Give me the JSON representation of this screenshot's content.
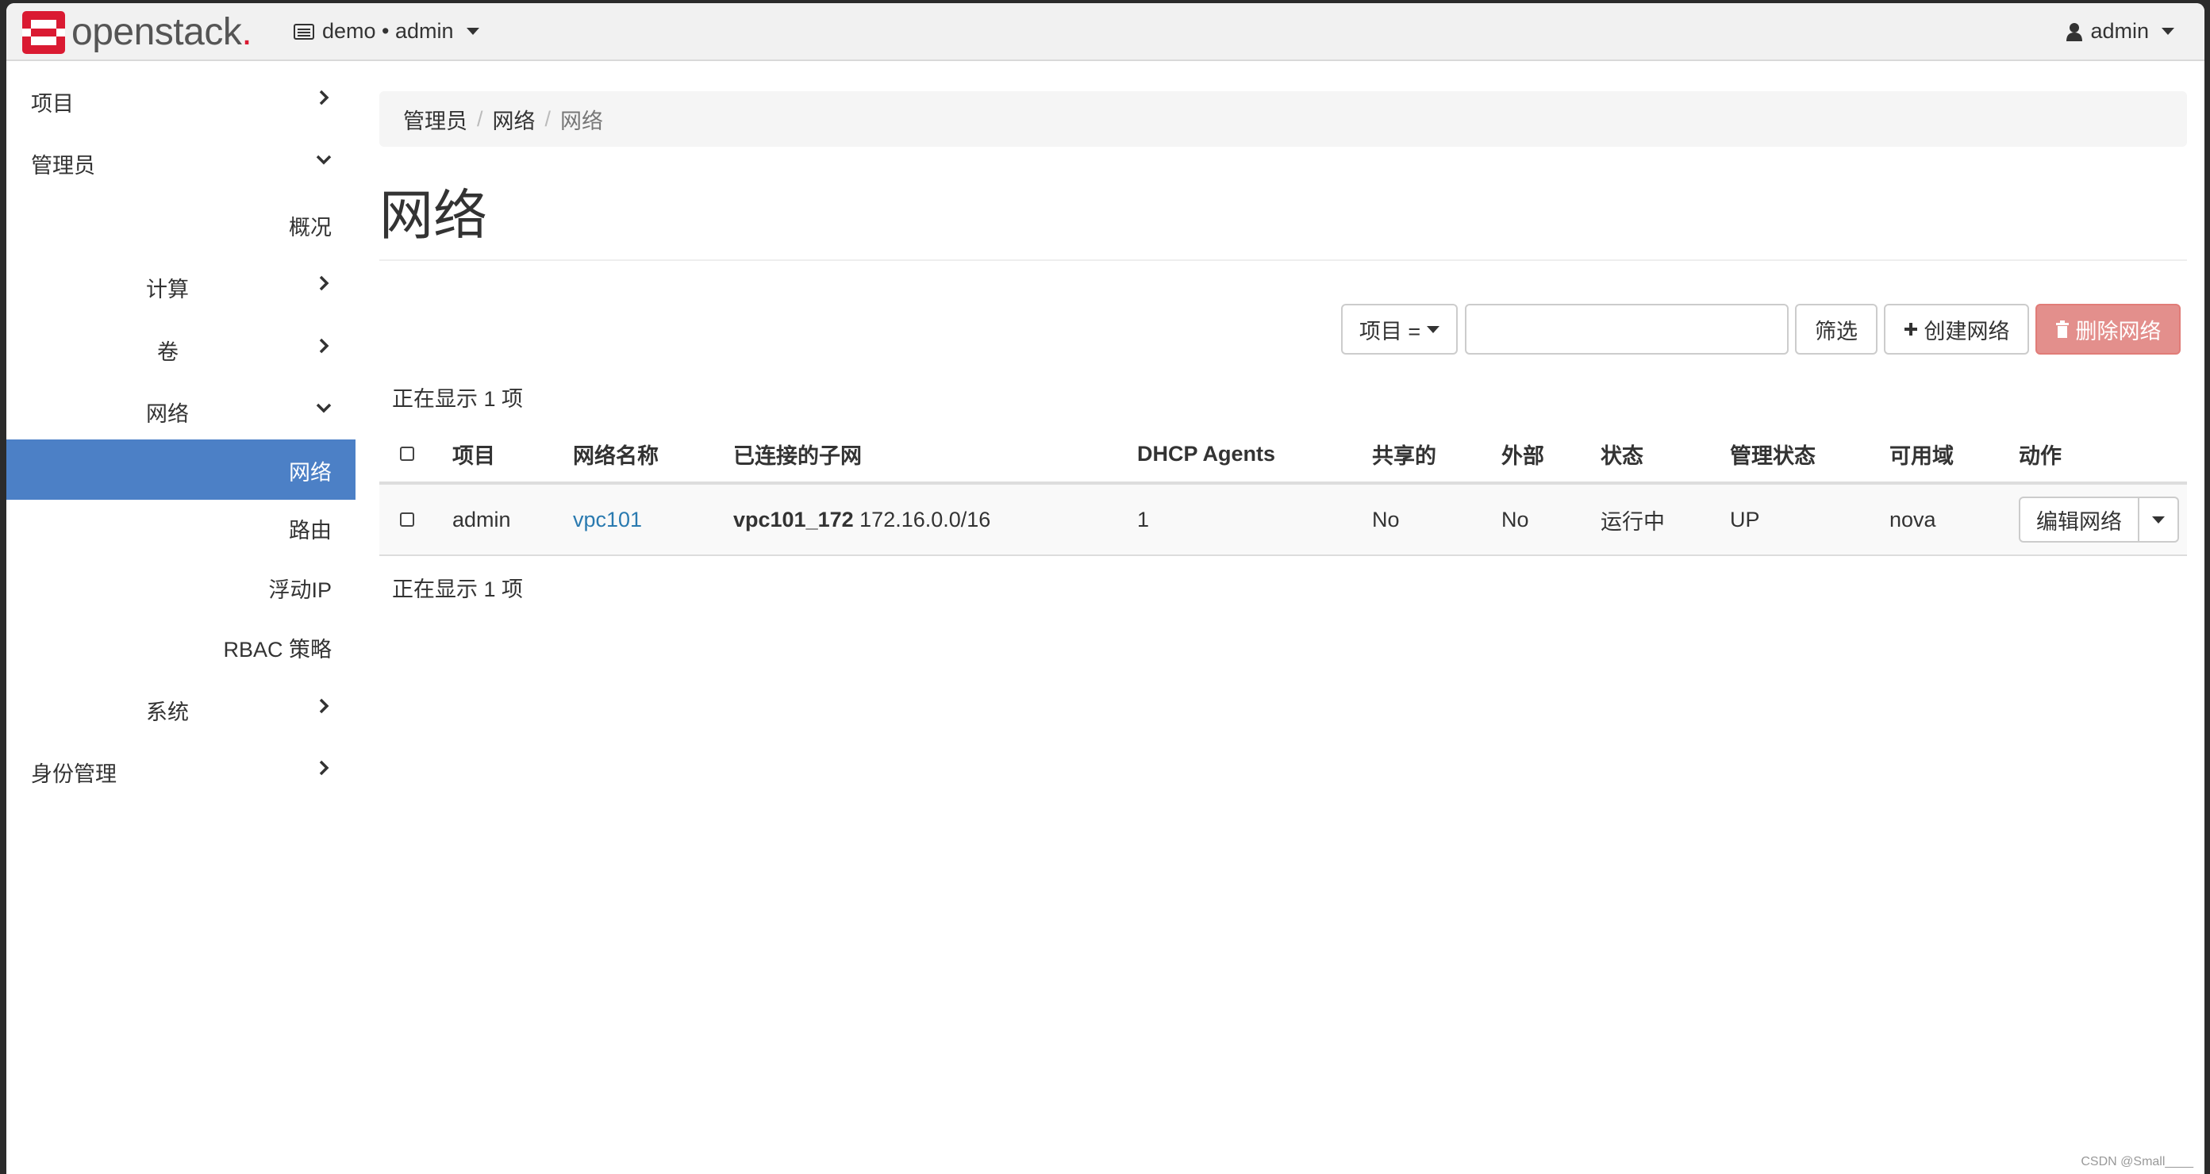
{
  "brand": {
    "name": "openstack",
    "dot": "."
  },
  "context": {
    "label": "demo • admin"
  },
  "user": {
    "name": "admin"
  },
  "sidebar": {
    "items": [
      {
        "label": "项目"
      },
      {
        "label": "管理员"
      },
      {
        "label": "概况"
      },
      {
        "label": "计算"
      },
      {
        "label": "卷"
      },
      {
        "label": "网络"
      },
      {
        "label": "网络"
      },
      {
        "label": "路由"
      },
      {
        "label": "浮动IP"
      },
      {
        "label": "RBAC 策略"
      },
      {
        "label": "系统"
      },
      {
        "label": "身份管理"
      }
    ]
  },
  "breadcrumb": {
    "root": "管理员",
    "mid": "网络",
    "current": "网络",
    "sep": "/"
  },
  "page": {
    "title": "网络"
  },
  "toolbar": {
    "filter_field": "项目 =",
    "search_value": "",
    "filter_label": "筛选",
    "create_label": "创建网络",
    "delete_label": "删除网络"
  },
  "summary": {
    "top": "正在显示 1 项",
    "bottom": "正在显示 1 项"
  },
  "table": {
    "headers": [
      "项目",
      "网络名称",
      "已连接的子网",
      "DHCP Agents",
      "共享的",
      "外部",
      "状态",
      "管理状态",
      "可用域",
      "动作"
    ],
    "rows": [
      {
        "project": "admin",
        "name": "vpc101",
        "subnet_name": "vpc101_172",
        "subnet_cidr": "172.16.0.0/16",
        "dhcp_agents": "1",
        "shared": "No",
        "external": "No",
        "status": "运行中",
        "admin_state": "UP",
        "zone": "nova",
        "action": "编辑网络"
      }
    ]
  },
  "watermark": "CSDN @Small____",
  "colors": {
    "active_nav": "#4c80c6",
    "danger": "#e38f8c",
    "link": "#2a7ab0",
    "brand_red": "#da1a32"
  }
}
